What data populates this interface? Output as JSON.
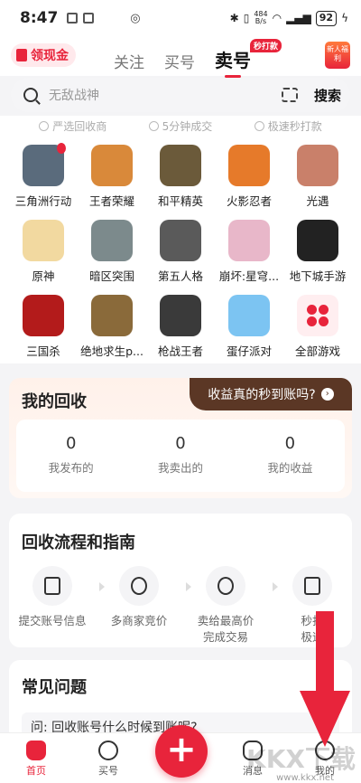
{
  "status_bar": {
    "time": "8:47",
    "net_speed_top": "484",
    "net_speed_bottom": "B/s",
    "battery": "92"
  },
  "header": {
    "cash_label": "领现金",
    "tabs": [
      {
        "label": "关注"
      },
      {
        "label": "买号"
      },
      {
        "label": "卖号"
      }
    ],
    "active_tab_badge": "秒打款",
    "newbie_gift_label": "新人福利"
  },
  "search": {
    "placeholder": "无敌战神",
    "button_label": "搜索"
  },
  "features": [
    "严选回收商",
    "5分钟成交",
    "极速秒打款"
  ],
  "games": [
    {
      "label": "三角洲行动",
      "color": "#5a6b7c",
      "hot": true
    },
    {
      "label": "王者荣耀",
      "color": "#d9893a"
    },
    {
      "label": "和平精英",
      "color": "#6b5a3a"
    },
    {
      "label": "火影忍者",
      "color": "#e67a2a"
    },
    {
      "label": "光遇",
      "color": "#c9806a"
    },
    {
      "label": "原神",
      "color": "#f2d9a0"
    },
    {
      "label": "暗区突围",
      "color": "#7c8a8c"
    },
    {
      "label": "第五人格",
      "color": "#5a5a5a"
    },
    {
      "label": "崩坏:星穹...",
      "color": "#e8b7c9"
    },
    {
      "label": "地下城手游",
      "color": "#222222"
    },
    {
      "label": "三国杀",
      "color": "#b31b1b"
    },
    {
      "label": "绝地求生p...",
      "color": "#8a6a3a"
    },
    {
      "label": "枪战王者",
      "color": "#3a3a3a"
    },
    {
      "label": "蛋仔派对",
      "color": "#7cc4f2"
    },
    {
      "label": "全部游戏",
      "color": "#ffeef0"
    }
  ],
  "recycle": {
    "title": "我的回收",
    "promo": "收益真的秒到账吗?",
    "stats": [
      {
        "value": "0",
        "label": "我发布的"
      },
      {
        "value": "0",
        "label": "我卖出的"
      },
      {
        "value": "0",
        "label": "我的收益"
      }
    ]
  },
  "guide": {
    "title": "回收流程和指南",
    "steps": [
      {
        "label": "提交账号信息"
      },
      {
        "label": "多商家竞价"
      },
      {
        "label": "卖给最高价\n完成交易"
      },
      {
        "label": "秒打\n极速"
      }
    ]
  },
  "faq": {
    "title": "常见问题",
    "question": "问: 回收账号什么时候到账呢?"
  },
  "bottom_nav": {
    "home": "首页",
    "buy": "买号",
    "message": "消息",
    "me": "我的"
  },
  "watermark": {
    "logo": "KKX下载",
    "url": "www.kkx.net"
  },
  "colors": {
    "accent": "#e8243b",
    "promo_bg": "#5b3725"
  }
}
